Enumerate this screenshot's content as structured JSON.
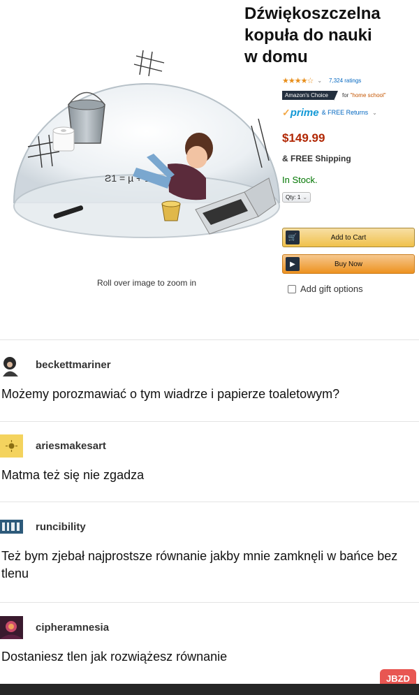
{
  "overlay_title": [
    "Dźwiękoszczelna",
    "kopuła do nauki",
    "w domu"
  ],
  "product": {
    "dome_caption": "Roll over image to zoom in",
    "dome_equation": "Ƨ1 = µ + 1",
    "stars": "★★★★☆",
    "ratings": "7,324 ratings",
    "choice_badge": "Amazon's Choice",
    "choice_for": "for ",
    "choice_term": "\"home school\"",
    "prime": "prime",
    "returns": "& FREE Returns",
    "price": "$149.99",
    "shipping": "& FREE Shipping",
    "stock": "In Stock.",
    "qty": "Qty: 1",
    "add_to_cart": "Add to Cart",
    "buy_now": "Buy Now",
    "gift": "Add gift options"
  },
  "comments": [
    {
      "user": "beckettmariner",
      "text": "Możemy porozmawiać o tym wiadrze i papierze toaletowym?"
    },
    {
      "user": "ariesmakesart",
      "text": "Matma też się nie zgadza"
    },
    {
      "user": "runcibility",
      "text": "Też bym zjebał najprostsze równanie jakby mnie zamknęli w bańce bez tlenu"
    },
    {
      "user": "cipheramnesia",
      "text": "Dostaniesz tlen jak rozwiążesz równanie"
    }
  ],
  "watermark": "JBZD",
  "colors": {
    "price": "#b12704",
    "stock": "#007600",
    "link": "#0066c0",
    "cart_button": "#f0c14b",
    "buy_button": "#ed9220"
  }
}
